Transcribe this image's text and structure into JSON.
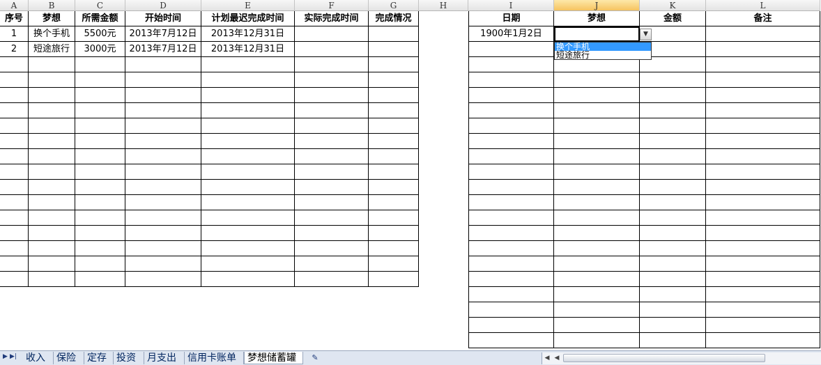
{
  "columns": [
    "A",
    "B",
    "C",
    "D",
    "E",
    "F",
    "G",
    "H",
    "I",
    "J",
    "K",
    "L"
  ],
  "active_column": "J",
  "left_table": {
    "headers": [
      "序号",
      "梦想",
      "所需金额",
      "开始时间",
      "计划最迟完成时间",
      "实际完成时间",
      "完成情况"
    ],
    "rows": [
      [
        "1",
        "换个手机",
        "5500元",
        "2013年7月12日",
        "2013年12月31日",
        "",
        ""
      ],
      [
        "2",
        "短途旅行",
        "3000元",
        "2013年7月12日",
        "2013年12月31日",
        "",
        ""
      ]
    ]
  },
  "right_table": {
    "headers": [
      "日期",
      "梦想",
      "金额",
      "备注"
    ],
    "rows": [
      [
        "1900年1月2日",
        "",
        "",
        ""
      ]
    ]
  },
  "dropdown": {
    "options": [
      "换个手机",
      "短途旅行"
    ],
    "selected_index": 0,
    "button_icon": "dropdown-arrow-icon"
  },
  "tabs": [
    "收入",
    "保险",
    "定存",
    "投资",
    "月支出",
    "信用卡账单",
    "梦想储蓄罐"
  ],
  "active_tab": "梦想储蓄罐",
  "icons": {
    "nav_next": "next-sheet-icon",
    "nav_last": "last-sheet-icon",
    "new_sheet": "insert-sheet-icon"
  }
}
